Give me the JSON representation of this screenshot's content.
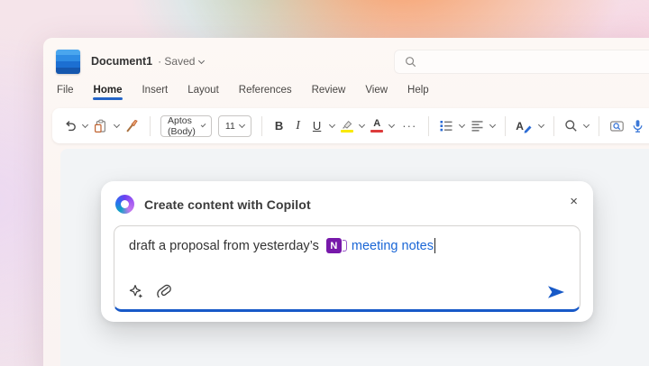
{
  "titlebar": {
    "document_title": "Document1",
    "separator": "·",
    "saved_status": "Saved"
  },
  "menu": {
    "items": [
      "File",
      "Home",
      "Insert",
      "Layout",
      "References",
      "Review",
      "View",
      "Help"
    ],
    "active": "Home"
  },
  "toolbar": {
    "font_name": "Aptos (Body)",
    "font_size": "11",
    "bold_label": "B",
    "italic_label": "I",
    "underline_label": "U",
    "more_label": "···",
    "font_color_label": "A",
    "styles_label": "A"
  },
  "icons": {
    "close_glyph": "×"
  },
  "copilot_dialog": {
    "title": "Create content with Copilot",
    "prompt_text": "draft a proposal from yesterday’s",
    "onenote_badge": "N",
    "linked_text": "meeting notes"
  },
  "colors": {
    "accent_blue": "#1859c8",
    "link_blue": "#1a66d6",
    "onenote_purple": "#7719aa",
    "highlight_yellow": "#f9e900",
    "font_color_red": "#dd3c3c"
  }
}
